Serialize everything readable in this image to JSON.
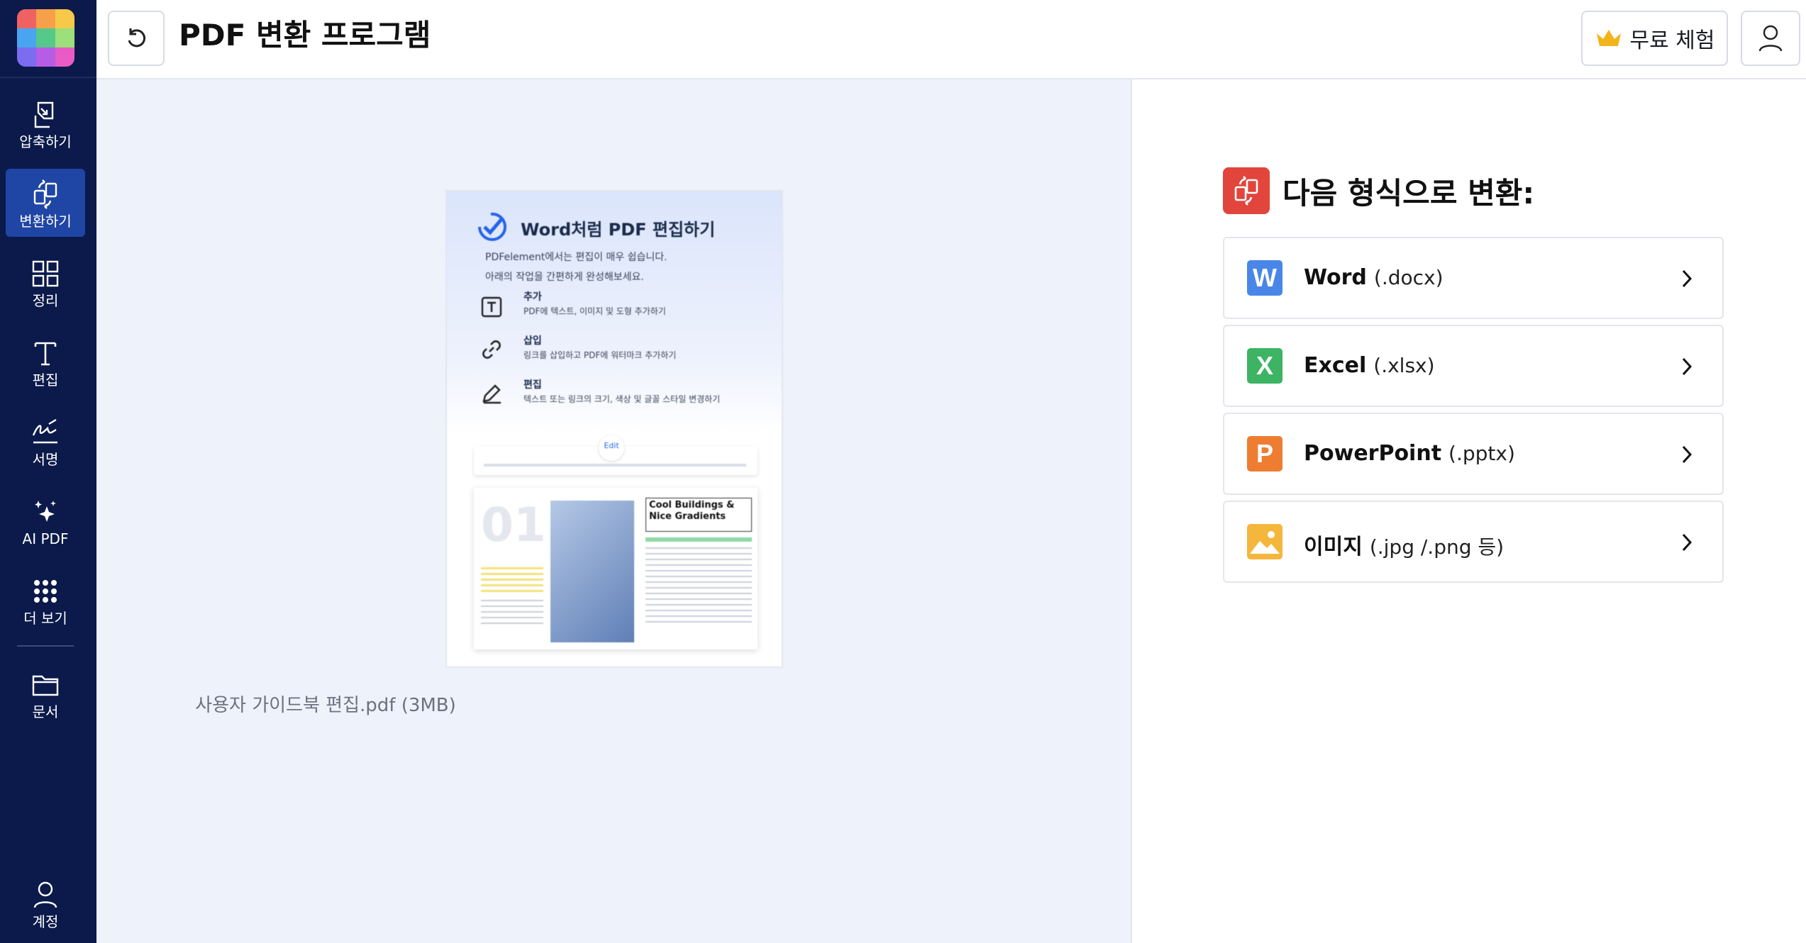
{
  "app": {
    "title": "PDF 변환 프로그램"
  },
  "header": {
    "trial_label": "무료 체험"
  },
  "sidebar": {
    "items": [
      {
        "label": "압축하기",
        "icon": "compress-icon"
      },
      {
        "label": "변환하기",
        "icon": "convert-icon",
        "active": true
      },
      {
        "label": "정리",
        "icon": "organize-icon"
      },
      {
        "label": "편집",
        "icon": "edit-text-icon"
      },
      {
        "label": "서명",
        "icon": "signature-icon"
      },
      {
        "label": "AI PDF",
        "icon": "ai-sparkle-icon"
      },
      {
        "label": "더 보기",
        "icon": "more-grid-icon"
      },
      {
        "label": "문서",
        "icon": "folder-icon"
      }
    ],
    "account_label": "계정"
  },
  "preview": {
    "file_name": "사용자 가이드북 편집.pdf (3MB)",
    "doc": {
      "title": "Word처럼 PDF 편집하기",
      "line1": "PDFelement에서는 편집이 매우 쉽습니다.",
      "line2": "아래의 작업을 간편하게 완성해보세요.",
      "rows": [
        {
          "head": "추가",
          "text": "PDF에 텍스트, 이미지 및 도형 추가하기"
        },
        {
          "head": "삽입",
          "text": "링크를 삽입하고 PDF에 워터마크 추가하기"
        },
        {
          "head": "편집",
          "text": "텍스트 또는 링크의 크기, 색상 및 글꼴 스타일 변경하기"
        }
      ],
      "toolbar_tab": "Edit",
      "page_number": "01",
      "page_heading": "Cool Buildings & Nice Gradients"
    }
  },
  "convert": {
    "title": "다음 형식으로 변환:",
    "formats": [
      {
        "name": "Word",
        "ext": "(.docx)",
        "letter": "W",
        "color": "#4a86e8"
      },
      {
        "name": "Excel",
        "ext": "(.xlsx)",
        "letter": "X",
        "color": "#3cb464"
      },
      {
        "name": "PowerPoint",
        "ext": "(.pptx)",
        "letter": "P",
        "color": "#ee7d32"
      },
      {
        "name": "이미지",
        "ext": "(.jpg /.png 등)",
        "letter": "",
        "color": "#f5b73b"
      }
    ]
  },
  "colors": {
    "sidebar_bg": "#0b1a4a",
    "sidebar_active": "#1f45a5",
    "convert_accent": "#e2453c",
    "crown": "#f2b41c"
  }
}
